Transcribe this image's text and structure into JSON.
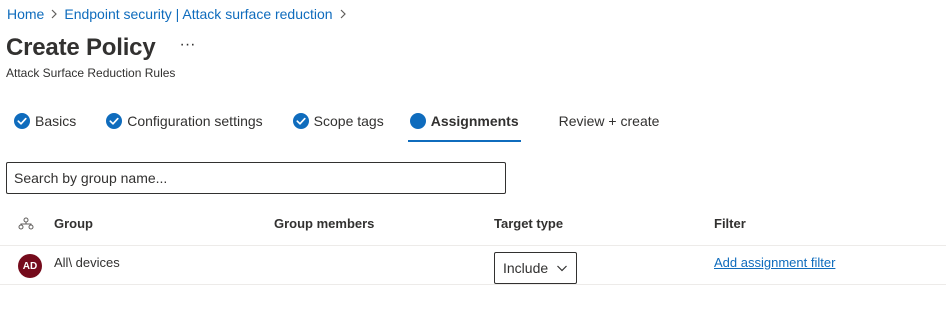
{
  "breadcrumb": [
    {
      "label": "Home"
    },
    {
      "label": "Endpoint security | Attack surface reduction"
    }
  ],
  "page": {
    "title": "Create Policy",
    "more_label": "···",
    "subtitle": "Attack Surface Reduction Rules"
  },
  "tabs": [
    {
      "label": "Basics",
      "state": "completed"
    },
    {
      "label": "Configuration settings",
      "state": "completed"
    },
    {
      "label": "Scope tags",
      "state": "completed"
    },
    {
      "label": "Assignments",
      "state": "current"
    },
    {
      "label": "Review + create",
      "state": "pending"
    }
  ],
  "search": {
    "placeholder": "Search by group name...",
    "value": ""
  },
  "table": {
    "columns": {
      "group": "Group",
      "members": "Group members",
      "target": "Target type",
      "filter": "Filter"
    },
    "rows": [
      {
        "avatar_initials": "AD",
        "avatar_color": "#750b1c",
        "group": "All\\ devices",
        "members": "",
        "target": "Include",
        "filter": "Add assignment filter"
      }
    ]
  },
  "colors": {
    "accent": "#0f6cbd",
    "text": "#323130",
    "avatar": "#750b1c",
    "divider": "#edebe9"
  },
  "icons": {
    "completed": "checkmark-circle-icon",
    "current": "filled-circle-icon",
    "separator": "chevron-right-icon",
    "header": "group-hierarchy-icon",
    "dropdown": "chevron-down-icon"
  }
}
